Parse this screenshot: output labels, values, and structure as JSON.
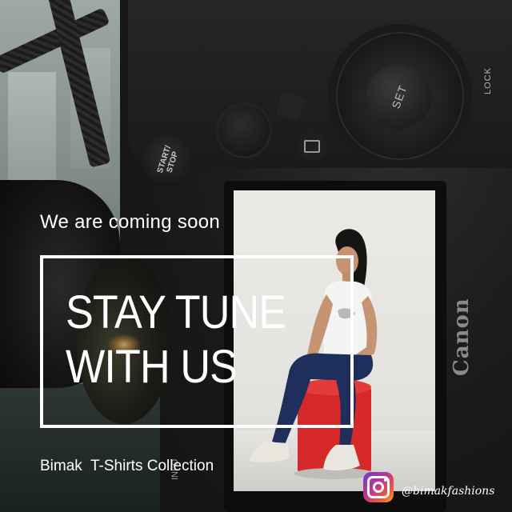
{
  "overlay": {
    "subtitle": "We are coming soon",
    "headline_line1": "STAY TUNE",
    "headline_line2": "WITH US",
    "collection": "Bimak  T-Shirts Collection"
  },
  "social": {
    "icon": "instagram-icon",
    "handle": "@bimakfashions"
  },
  "camera": {
    "set_label": "SET",
    "start_stop_label_1": "START/",
    "start_stop_label_2": "STOP",
    "lock_label": "LOCK",
    "info_label": "INFO",
    "brand": "Canon"
  },
  "colors": {
    "text": "#ffffff",
    "frame": "#ffffff",
    "stool": "#d62a2a",
    "jeans": "#1f2f5c",
    "shirt": "#f4f4f2"
  }
}
